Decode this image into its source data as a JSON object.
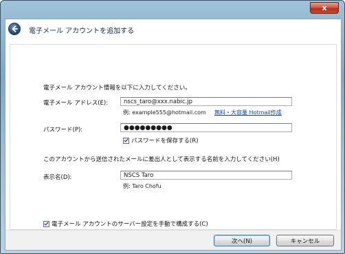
{
  "window": {
    "close_label": "x"
  },
  "header": {
    "title": "電子メール アカウントを追加する"
  },
  "form": {
    "intro": "電子メール アカウント情報を以下に入力してください。",
    "email": {
      "label": "電子メール アドレス(E):",
      "value": "nscs_taro@xxx.nabic.jp",
      "example": "例: example555@hotmail.com",
      "link": "無料・大容量 Hotmail作成"
    },
    "password": {
      "label": "パスワード(P):",
      "masked_value": "●●●●●●●●●",
      "remember_label": "パスワードを保存する(R)",
      "remember_checked": true
    },
    "display_prompt": "このアカウントから送信されたメールに差出人として表示する名前を入力してください(H)",
    "display_name": {
      "label": "表示名(D):",
      "value": "NSCS Taro",
      "example": "例: Taro Chofu"
    },
    "manual_config": {
      "label": "電子メール アカウントのサーバー設定を手動で構成する(C)",
      "checked": true
    }
  },
  "buttons": {
    "next": "次へ(N)",
    "cancel": "キャンセル"
  },
  "icons": {
    "back": "back-arrow-icon",
    "close": "close-icon",
    "check": "checkmark-icon"
  }
}
